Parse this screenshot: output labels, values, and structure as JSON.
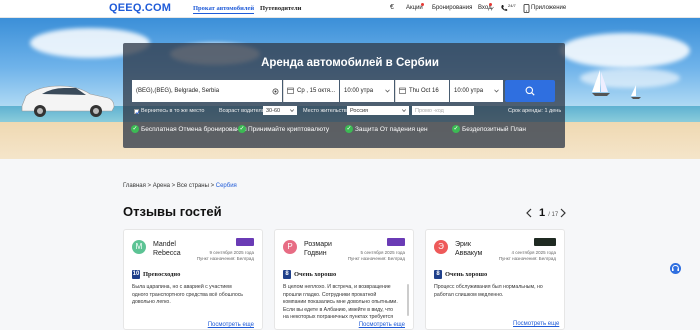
{
  "nav": {
    "logo": "QEEQ.COM",
    "links": [
      "Прокат автомобилей",
      "Путеводители"
    ],
    "right": {
      "currency": "€",
      "deals": "Акции",
      "bookings": "Бронирования",
      "login": "Вход",
      "support": "24/7",
      "app": "Приложение"
    }
  },
  "hero": {
    "title": "Аренда автомобилей в Сербии",
    "pickup_location": "(BEG),(BEG), Belgrade, Serbia",
    "pickup_date": "Ср , 15 октя...",
    "pickup_time": "10:00 утра",
    "return_date": "Thu Oct 16",
    "return_time": "10:00 утра",
    "return_same": "Вернитесь в то же место",
    "driver_age_label": "Возраст водителя:",
    "driver_age": "30-60",
    "residence_label": "Место жительства:",
    "residence": "Россия",
    "promo_placeholder": "Промо -код",
    "rental_duration": "Срок аренды: 1 день",
    "features": [
      "Бесплатная Отмена бронирования",
      "Принимайте криптовалюту",
      "Защита От падения цен",
      "Бездепозитный План"
    ]
  },
  "breadcrumb": {
    "items": [
      "Главная",
      "Арена",
      "Все страны"
    ],
    "current": "Сербия"
  },
  "reviews": {
    "title": "Отзывы гостей",
    "page": "1",
    "total": "/ 17",
    "more_label": "Посмотреть еще",
    "items": [
      {
        "initial": "M",
        "name1": "Mandel",
        "name2": "Rebecca",
        "date": "9 сентября 2025 года",
        "location": "Пункт назначения: Белград",
        "score": "10",
        "verdict": "Превосходно",
        "text": "Была царапина, но с аварией с участием одного транспортного средства всё обошлось довольно легко."
      },
      {
        "initial": "Р",
        "name1": "Розмари",
        "name2": "Годвин",
        "date": "5 сентября 2025 года",
        "location": "Пункт назначения: Белград",
        "score": "8",
        "verdict": "Очень хорошо",
        "text": "В целом неплохо. И встреча, и возвращение прошли гладко. Сотрудники прокатной компании показались мне довольно опытными. Если вы едете в Албанию, имейте в виду, что на некоторых пограничных пунктах требуется предъявить"
      },
      {
        "initial": "Э",
        "name1": "Эрик",
        "name2": "Аввакум",
        "date": "4 сентября 2025 года",
        "location": "Пункт назначения: Белград",
        "score": "8",
        "verdict": "Очень хорошо",
        "text": "Процесс обслуживания был нормальным, но работал слишком медленно."
      }
    ]
  },
  "colors": {
    "brand": "#1f5bd8",
    "search_button": "#2f6fe0",
    "check": "#3cba54",
    "avatar_1": "#5cc394",
    "avatar_2": "#e76c84",
    "avatar_3": "#ee5a5a"
  }
}
